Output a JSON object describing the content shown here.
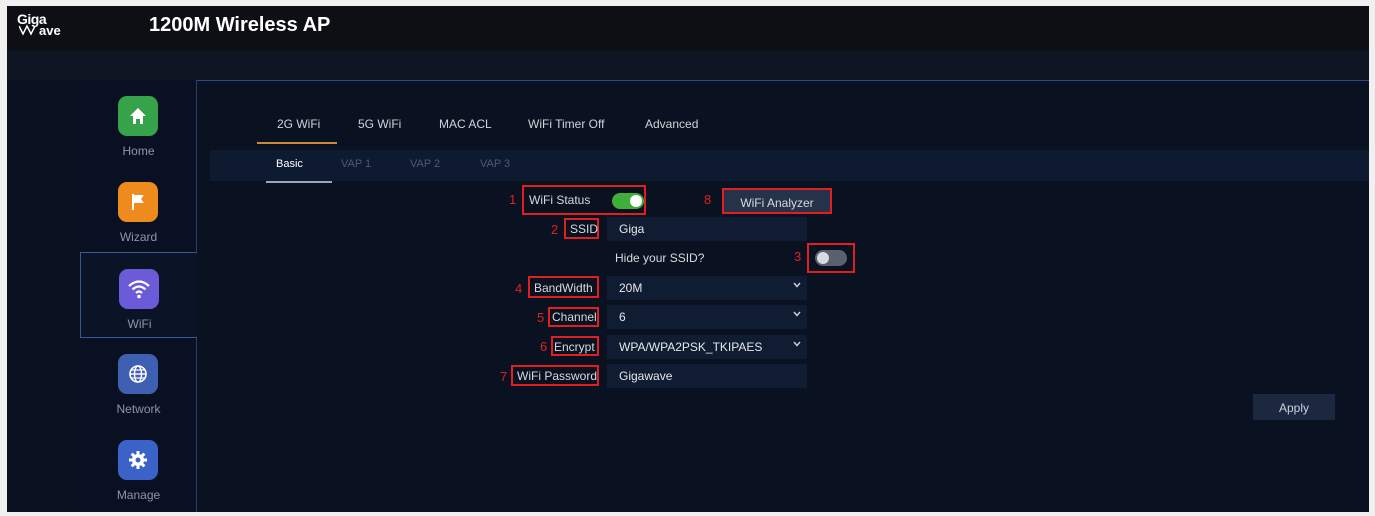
{
  "header": {
    "logo_text_top": "Giga",
    "logo_text_bottom": "ave",
    "title": "1200M Wireless AP"
  },
  "sidebar": {
    "items": [
      {
        "label": "Home",
        "icon": "home-icon"
      },
      {
        "label": "Wizard",
        "icon": "flag-icon"
      },
      {
        "label": "WiFi",
        "icon": "wifi-icon",
        "active": true
      },
      {
        "label": "Network",
        "icon": "globe-icon"
      },
      {
        "label": "Manage",
        "icon": "gear-icon"
      }
    ]
  },
  "tabs": [
    "2G WiFi",
    "5G WiFi",
    "MAC ACL",
    "WiFi Timer Off",
    "Advanced"
  ],
  "active_tab": "2G WiFi",
  "subtabs": [
    "Basic",
    "VAP 1",
    "VAP 2",
    "VAP 3"
  ],
  "active_subtab": "Basic",
  "form": {
    "wifi_status": {
      "num": "1",
      "label": "WiFi Status",
      "enabled": true
    },
    "analyzer": {
      "num": "8",
      "label": "WiFi Analyzer"
    },
    "ssid": {
      "num": "2",
      "label": "SSID",
      "value": "Giga"
    },
    "hide_ssid": {
      "num": "3",
      "label": "Hide your SSID?",
      "enabled": false
    },
    "bandwidth": {
      "num": "4",
      "label": "BandWidth",
      "value": "20M"
    },
    "channel": {
      "num": "5",
      "label": "Channel",
      "value": "6"
    },
    "encrypt": {
      "num": "6",
      "label": "Encrypt",
      "value": "WPA/WPA2PSK_TKIPAES"
    },
    "password": {
      "num": "7",
      "label": "WiFi Password",
      "value": "Gigawave"
    }
  },
  "apply_label": "Apply",
  "colors": {
    "accent_orange": "#c98a3b",
    "annotation_red": "#e02020",
    "toggle_on": "#3fae3a",
    "toggle_off": "#5a6070"
  }
}
